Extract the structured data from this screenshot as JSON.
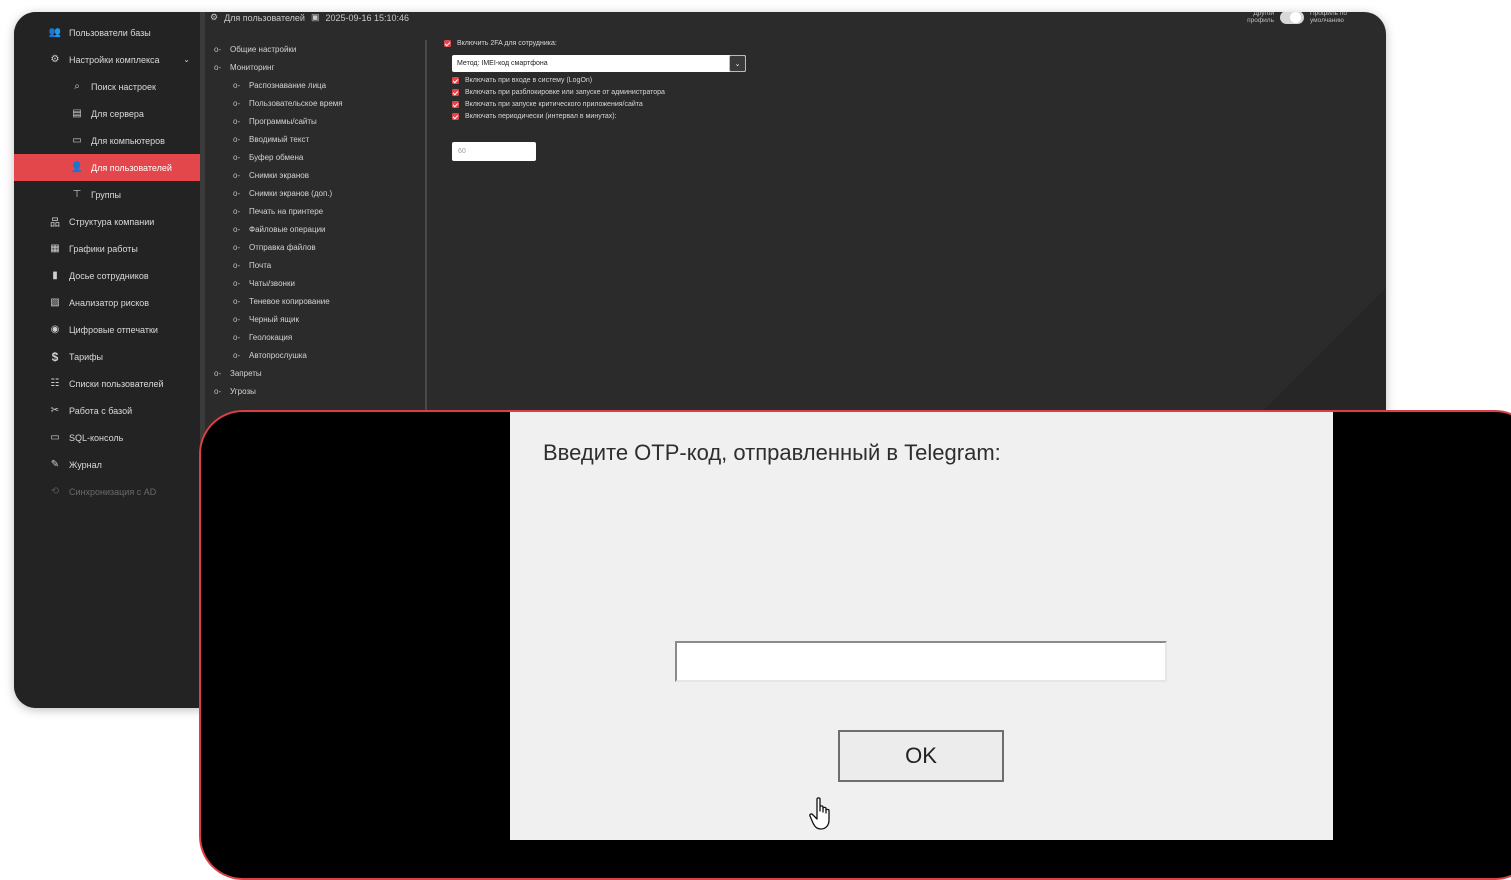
{
  "sidebar": {
    "items": [
      {
        "label": "Пользователи базы",
        "icon": "users-icon",
        "glyph": "👥"
      },
      {
        "label": "Настройки комплекса",
        "icon": "settings-users-icon",
        "glyph": "⚙",
        "chevron": "⌄"
      },
      {
        "label": "Поиск настроек",
        "icon": "search-icon",
        "glyph": "⌕"
      },
      {
        "label": "Для сервера",
        "icon": "server-icon",
        "glyph": "▤"
      },
      {
        "label": "Для компьютеров",
        "icon": "computer-icon",
        "glyph": "▭"
      },
      {
        "label": "Для пользователей",
        "icon": "user-icon",
        "glyph": "👤"
      },
      {
        "label": "Группы",
        "icon": "groups-icon",
        "glyph": "⊤"
      },
      {
        "label": "Структура компании",
        "icon": "org-structure-icon",
        "glyph": "品"
      },
      {
        "label": "Графики работы",
        "icon": "calendar-icon",
        "glyph": "▦"
      },
      {
        "label": "Досье сотрудников",
        "icon": "dossier-icon",
        "glyph": "▮"
      },
      {
        "label": "Анализатор рисков",
        "icon": "risk-analyzer-icon",
        "glyph": "▧"
      },
      {
        "label": "Цифровые отпечатки",
        "icon": "fingerprint-icon",
        "glyph": "◉"
      },
      {
        "label": "Тарифы",
        "icon": "dollar-icon",
        "glyph": "$"
      },
      {
        "label": "Списки пользователей",
        "icon": "user-list-icon",
        "glyph": "☷"
      },
      {
        "label": "Работа с базой",
        "icon": "tools-icon",
        "glyph": "✂"
      },
      {
        "label": "SQL-консоль",
        "icon": "console-icon",
        "glyph": "▭"
      },
      {
        "label": "Журнал",
        "icon": "journal-icon",
        "glyph": "✎"
      },
      {
        "label": "Синхронизация с AD",
        "icon": "sync-icon",
        "glyph": "⟲"
      }
    ]
  },
  "topbar": {
    "page_label": "Для пользователей",
    "timestamp": "2025-09-16 15:10:46",
    "toggle_left": "Другой профиль",
    "toggle_right": "Профиль по умолчанию"
  },
  "tree": {
    "items": [
      {
        "label": "Общие настройки",
        "level": 0
      },
      {
        "label": "Мониторинг",
        "level": 0
      },
      {
        "label": "Распознавание лица",
        "level": 1
      },
      {
        "label": "Пользовательское время",
        "level": 1
      },
      {
        "label": "Программы/сайты",
        "level": 1
      },
      {
        "label": "Вводимый текст",
        "level": 1
      },
      {
        "label": "Буфер обмена",
        "level": 1
      },
      {
        "label": "Снимки экранов",
        "level": 1
      },
      {
        "label": "Снимки экранов (доп.)",
        "level": 1
      },
      {
        "label": "Печать на принтере",
        "level": 1
      },
      {
        "label": "Файловые операции",
        "level": 1
      },
      {
        "label": "Отправка файлов",
        "level": 1
      },
      {
        "label": "Почта",
        "level": 1
      },
      {
        "label": "Чаты/звонки",
        "level": 1
      },
      {
        "label": "Теневое копирование",
        "level": 1
      },
      {
        "label": "Черный ящик",
        "level": 1
      },
      {
        "label": "Геолокация",
        "level": 1
      },
      {
        "label": "Автопрослушка",
        "level": 1
      },
      {
        "label": "Запреты",
        "level": 0
      },
      {
        "label": "Угрозы",
        "level": 0
      }
    ]
  },
  "settings": {
    "enable_2fa": "Включить 2FA для сотрудника:",
    "method": "Метод: IMEI-код смартфона",
    "options": [
      "Включать при входе в систему (LogOn)",
      "Включать при разблокировке или запуске от администратора",
      "Включать при запуске критического приложения/сайта",
      "Включать периодически (интервал в минутах):"
    ],
    "interval_value": "60"
  },
  "dialog": {
    "prompt": "Введите OTP-код, отправленный в Telegram:",
    "ok_label": "OK"
  },
  "colors": {
    "accent": "#e3474b",
    "app_background": "#2b2b2b",
    "sidebar_background": "#232323",
    "dialog_background": "#f0f0f0"
  }
}
